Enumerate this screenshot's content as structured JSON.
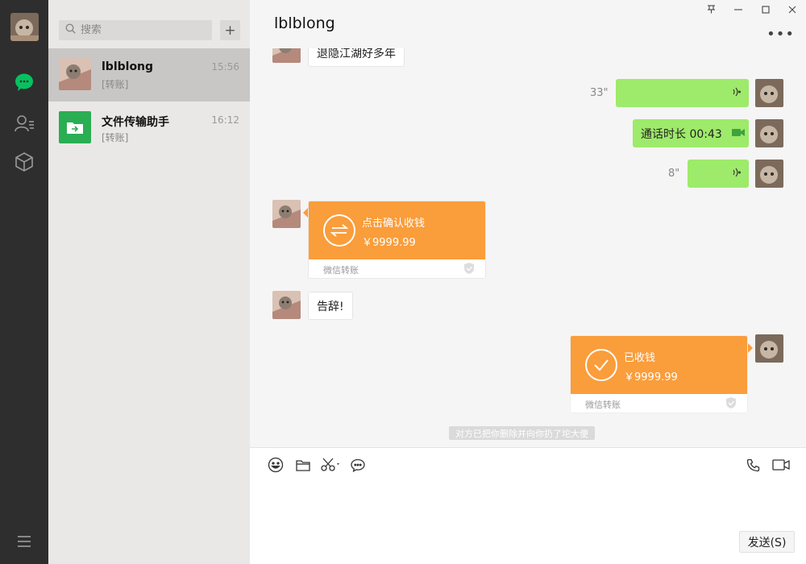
{
  "search": {
    "placeholder": "搜索"
  },
  "sessions": [
    {
      "name": "lblblong",
      "time": "15:56",
      "preview": "[转账]"
    },
    {
      "name": "文件传输助手",
      "time": "16:12",
      "preview": "[转账]"
    }
  ],
  "chat": {
    "title": "lblblong",
    "more": "•••",
    "messages": {
      "partial_text": "退隐江湖好多年",
      "voice1_duration": "33\"",
      "call_text": "通话时长 00:43",
      "voice2_duration": "8\"",
      "transfer_in": {
        "title": "点击确认收钱",
        "amount": "￥9999.99",
        "footer": "微信转账"
      },
      "farewell": "告辞!",
      "transfer_out": {
        "title": "已收钱",
        "amount": "￥9999.99",
        "footer": "微信转账"
      },
      "system_note": "对方已把你删除并向你扔了坨大便"
    }
  },
  "input": {
    "send_label": "发送(S)"
  },
  "colors": {
    "accent_green": "#07c160",
    "bubble_green": "#9eea6a",
    "transfer_orange": "#fa9d3b",
    "nav_bg": "#2e2e2e"
  },
  "icons": [
    "chat-icon",
    "contacts-icon",
    "cube-icon",
    "menu-icon",
    "search-icon",
    "plus-icon",
    "pin-icon",
    "minimize-icon",
    "maximize-icon",
    "close-icon",
    "emoji-icon",
    "folder-icon",
    "scissors-icon",
    "chat-history-icon",
    "phone-icon",
    "video-icon",
    "voice-wave-icon",
    "video-call-icon",
    "transfer-icon",
    "check-icon",
    "shield-icon"
  ]
}
